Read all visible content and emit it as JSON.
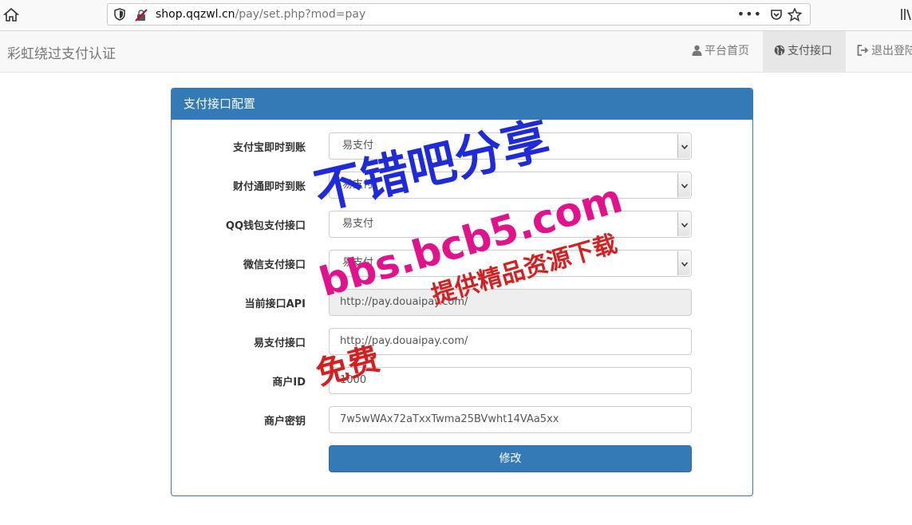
{
  "browser": {
    "url_domain": "shop.qqzwl.cn",
    "url_path": "/pay/set.php?mod=pay",
    "menu_dots": "•••"
  },
  "navbar": {
    "brand": "彩虹绕过支付认证",
    "items": [
      {
        "label": "平台首页",
        "icon": "user-icon"
      },
      {
        "label": "支付接口",
        "icon": "globe-icon"
      },
      {
        "label": "退出登陆",
        "icon": "logout-icon"
      }
    ]
  },
  "panel": {
    "title": "支付接口配置",
    "fields": {
      "alipay": {
        "label": "支付宝即时到账",
        "value": "易支付"
      },
      "tenpay": {
        "label": "财付通即时到账",
        "value": "易支付"
      },
      "qqpay": {
        "label": "QQ钱包支付接口",
        "value": "易支付"
      },
      "wxpay": {
        "label": "微信支付接口",
        "value": "易支付"
      },
      "current_api": {
        "label": "当前接口API",
        "value": "http://pay.douaipay.com/"
      },
      "epay_api": {
        "label": "易支付接口",
        "value": "http://pay.douaipay.com/"
      },
      "merchant_id": {
        "label": "商户ID",
        "value": "1000"
      },
      "merchant_key": {
        "label": "商户密钥",
        "value": "7w5wWAx72aTxxTwma25BVwht14VAa5xx"
      }
    },
    "submit_label": "修改"
  },
  "watermarks": {
    "line1": "不错吧分享",
    "line2": "bbs.bcb5.com",
    "line3": "提供精品资源下载",
    "line4": "免费"
  }
}
